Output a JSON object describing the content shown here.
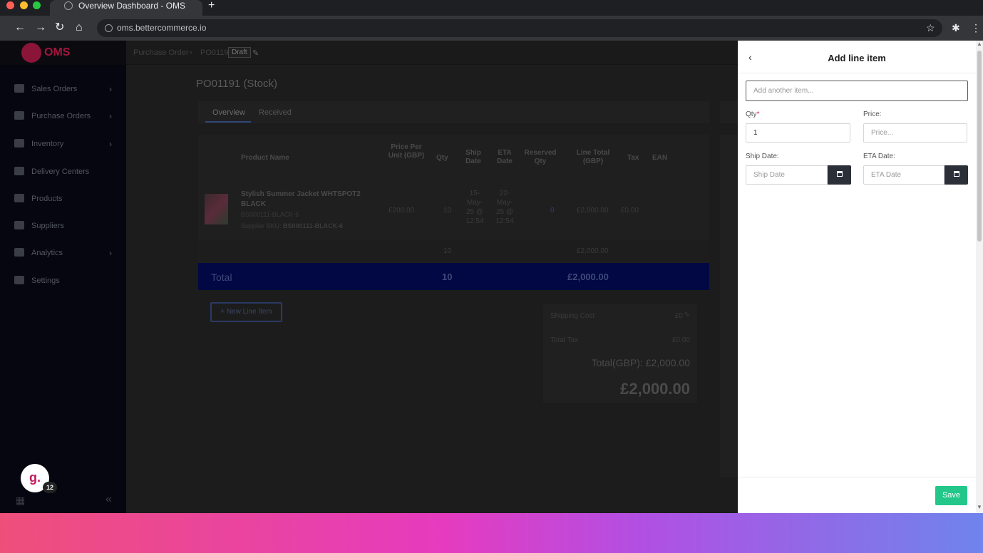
{
  "browser": {
    "tab_title": "Overview Dashboard - OMS",
    "url": "oms.bettercommerce.io"
  },
  "sidebar": {
    "logo_text": "OMS",
    "items": [
      {
        "label": "Sales Orders",
        "has_chevron": true
      },
      {
        "label": "Purchase Orders",
        "has_chevron": true
      },
      {
        "label": "Inventory",
        "has_chevron": true
      },
      {
        "label": "Delivery Centers",
        "has_chevron": false
      },
      {
        "label": "Products",
        "has_chevron": false
      },
      {
        "label": "Suppliers",
        "has_chevron": false
      },
      {
        "label": "Analytics",
        "has_chevron": true
      },
      {
        "label": "Settings",
        "has_chevron": false
      }
    ],
    "avatar_letter": "g.",
    "badge_count": "12"
  },
  "breadcrumb": {
    "root": "Purchase Order",
    "id": "PO01191",
    "status": "Draft"
  },
  "page": {
    "title": "PO01191 (Stock)",
    "tabs": [
      "Overview",
      "Received"
    ]
  },
  "table": {
    "headers": {
      "product_name": "Product Name",
      "price_per_unit": "Price Per Unit (GBP)",
      "qty": "Qty",
      "ship_date": "Ship Date",
      "eta_date": "ETA Date",
      "reserved_qty": "Reserved Qty",
      "line_total": "Line Total (GBP)",
      "tax": "Tax",
      "ean": "EAN"
    },
    "row": {
      "name": "Stylish Summer Jacket WHTSPOT2 BLACK",
      "sku": "BS000111-BLACK-6",
      "supplier_sku_label": "Supplier SKU:",
      "supplier_sku": "BS000111-BLACK-6",
      "price": "£200.00",
      "qty": "10",
      "ship_date": "15-May-25 @ 12:54",
      "eta_date": "22-May-25 @ 12:54",
      "reserved": "0",
      "line_total": "£2,000.00",
      "tax": "£0.00"
    },
    "subtotal": {
      "qty": "10",
      "line_total": "£2,000.00"
    },
    "total": {
      "label": "Total",
      "qty": "10",
      "amount": "£2,000.00"
    }
  },
  "actions": {
    "new_line_item": "+ New Line Item"
  },
  "summary": {
    "shipping_label": "Shipping Cost",
    "shipping_value": "£0",
    "tax_label": "Total Tax",
    "tax_value": "£0.00",
    "total_line": "Total(GBP): £2,000.00",
    "total_big": "£2,000.00"
  },
  "drawer": {
    "title": "Add line item",
    "item_placeholder": "Add another item...",
    "qty_label": "Qty",
    "qty_value": "1",
    "price_label": "Price:",
    "price_placeholder": "Price...",
    "ship_label": "Ship Date:",
    "ship_placeholder": "Ship Date",
    "eta_label": "ETA Date:",
    "eta_placeholder": "ETA Date",
    "save": "Save"
  },
  "colors": {
    "accent_navy": "#010843",
    "save_green": "#23c78a",
    "brand": "#a4163f"
  }
}
